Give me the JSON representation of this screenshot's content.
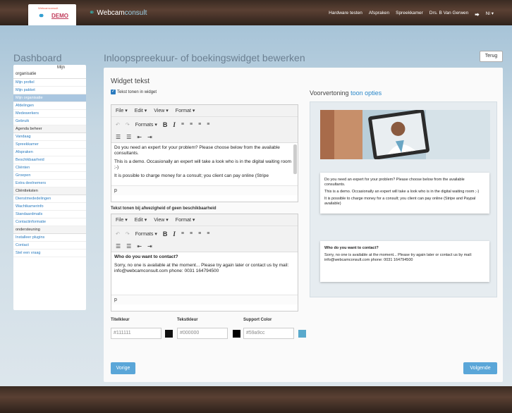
{
  "header": {
    "logo_tagline": "Webcamconsult",
    "logo_symbol": "⚭",
    "logo_demo": "DEMO",
    "brand_symbol": "⚭",
    "brand_name_a": "Webcam",
    "brand_name_b": "consult",
    "nav": [
      "Hardware testen",
      "Afspraken",
      "Spreekkamer",
      "Drs. B Van Gerwen",
      "⮕",
      "Nl ▾"
    ]
  },
  "dashboard_title": "Dashboard",
  "page_title": "Inloopspreekuur- of boekingswidget bewerken",
  "back_label": "Terug",
  "sidebar": {
    "top_right": "Mijn",
    "top_left": "organisatie",
    "items": [
      {
        "label": "Mijn profiel",
        "type": "link"
      },
      {
        "label": "Mijn pakket",
        "type": "link"
      },
      {
        "label": "Mijn organisatie",
        "type": "active"
      },
      {
        "label": "Afdelingen",
        "type": "link"
      },
      {
        "label": "Medewerkers",
        "type": "link"
      },
      {
        "label": "Gebruik",
        "type": "link"
      },
      {
        "label": "Agenda beheer",
        "type": "head"
      },
      {
        "label": "Vandaag",
        "type": "link"
      },
      {
        "label": "Spreekkamer",
        "type": "link"
      },
      {
        "label": "Afspraken",
        "type": "link"
      },
      {
        "label": "Beschikbaarheid",
        "type": "link"
      },
      {
        "label": "Cliënten",
        "type": "link"
      },
      {
        "label": "Groepen",
        "type": "link"
      },
      {
        "label": "Extra deelnemers",
        "type": "link"
      },
      {
        "label": "Cliëntteksten",
        "type": "head"
      },
      {
        "label": "Dienstmededelingen",
        "type": "link"
      },
      {
        "label": "Wachtkamerinfo",
        "type": "link"
      },
      {
        "label": "Standaardmails",
        "type": "link"
      },
      {
        "label": "Contactinformatie",
        "type": "link"
      },
      {
        "label": "ondersteuning",
        "type": "head"
      },
      {
        "label": "Installeer plugins",
        "type": "link"
      },
      {
        "label": "Contact",
        "type": "link"
      },
      {
        "label": "Stel een vraag",
        "type": "link"
      }
    ]
  },
  "widget": {
    "section_title": "Widget tekst",
    "checkbox_label": "Tekst tonen in widget",
    "menu": [
      "File ▾",
      "Edit ▾",
      "View ▾",
      "Format ▾"
    ],
    "formats_label": "Formats ▾",
    "bold": "B",
    "italic": "I",
    "editor1": {
      "lines": [
        "Do you need an expert for your problem? Please choose below from the available consultants.",
        "This is a demo. Occasionally an expert will take a look who is in the digital waiting room ;-)",
        "It is possible to charge money for a consult; you client can pay online (Stripe"
      ],
      "footer": "p"
    },
    "absent_label": "Tekst tonen bij afwezigheid of geen beschikbaarheid",
    "editor2": {
      "heading": "Who do you want to contact?",
      "body": "Sorry, no one is available at the moment... Please try again later or contact us by  mail: info@webcamconsult.com  phone: 0031 164794500",
      "footer": "p"
    },
    "colors": {
      "title_label": "Titelkleur",
      "title_value": "#111111",
      "text_label": "Tekstkleur",
      "text_value": "#000000",
      "support_label": "Support Color",
      "support_value": "#59a9cc",
      "title_swatch": "#111111",
      "text_swatch": "#000000",
      "support_swatch": "#59a9cc"
    }
  },
  "preview": {
    "title_a": "Voorvertoning",
    "title_b": "toon opties",
    "card1_lines": [
      "Do you need an expert for your problem? Please choose below from the available consultants.",
      "This is a demo. Occasionally an expert will take a look who is in the digital waiting room ;-)",
      "It is possible to charge money for a consult; you client can pay online (Stripe and Paypal available)"
    ],
    "card2_heading": "Who do you want to contact?",
    "card2_body": "Sorry, no one is available at the moment... Please try again later or contact us by  mail: info@webcamconsult.com  phone: 0031 164794500"
  },
  "footer_buttons": {
    "prev": "Vorige",
    "next": "Volgende"
  }
}
